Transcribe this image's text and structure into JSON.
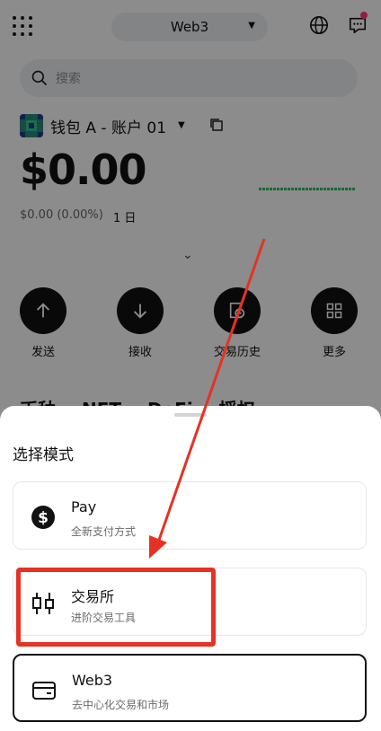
{
  "header": {
    "mode_label": "Web3",
    "icons": [
      "apps-grid-icon",
      "globe-icon",
      "support-chat-icon"
    ]
  },
  "search": {
    "placeholder": "搜索"
  },
  "wallet": {
    "name": "钱包 A - 账户 01",
    "balance": "$0.00",
    "change": "$0.00 (0.00%)",
    "period": "1 日"
  },
  "actions": [
    {
      "label": "发送",
      "icon": "arrow-up-icon"
    },
    {
      "label": "接收",
      "icon": "arrow-down-icon"
    },
    {
      "label": "交易历史",
      "icon": "history-icon"
    },
    {
      "label": "更多",
      "icon": "grid-icon"
    }
  ],
  "tabs_peek": [
    "币种",
    "NFT",
    "DeFi",
    "授权"
  ],
  "sheet": {
    "title": "选择模式",
    "options": [
      {
        "title": "Pay",
        "subtitle": "全新支付方式",
        "icon": "dollar-icon"
      },
      {
        "title": "交易所",
        "subtitle": "进阶交易工具",
        "icon": "candlestick-icon"
      },
      {
        "title": "Web3",
        "subtitle": "去中心化交易和市场",
        "icon": "wallet-card-icon",
        "selected": true
      }
    ]
  },
  "colors": {
    "accent_annotation": "#e53224",
    "overlay": "rgba(0,0,0,0.45)",
    "dark": "#111111",
    "notification_dot": "#ff3b7a"
  }
}
